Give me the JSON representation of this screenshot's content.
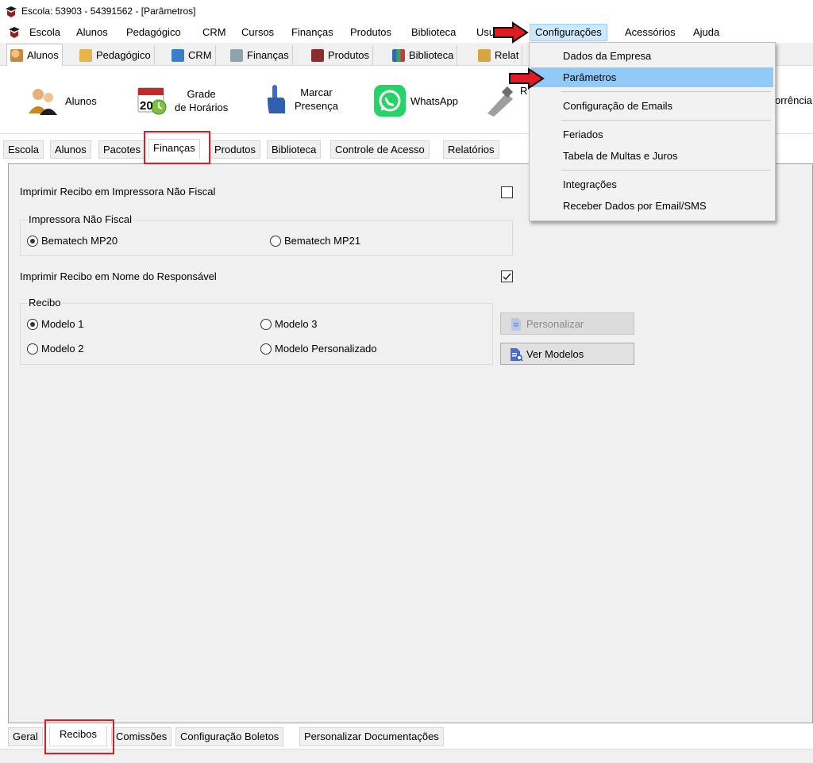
{
  "window": {
    "title": "Escola: 53903 - 54391562 - [Parâmetros]"
  },
  "menubar": {
    "items": [
      "Escola",
      "Alunos",
      "Pedagógico",
      "CRM",
      "Cursos",
      "Finanças",
      "Produtos",
      "Biblioteca",
      "Usu",
      "Configurações",
      "Acessórios",
      "Ajuda"
    ]
  },
  "toolbar_tabs": [
    "Alunos",
    "Pedagógico",
    "CRM",
    "Finanças",
    "Produtos",
    "Biblioteca",
    "Relat"
  ],
  "ribbon": {
    "alunos": "Alunos",
    "grade_line1": "Grade",
    "grade_line2": "de Horários",
    "grade_day": "20",
    "marcar_line1": "Marcar",
    "marcar_line2": "Presença",
    "whatsapp": "WhatsApp",
    "partial_r": "R",
    "ocorrencia": "orrência"
  },
  "secondary_tabs": [
    "Escola",
    "Alunos",
    "Pacotes",
    "Finanças",
    "Produtos",
    "Biblioteca",
    "Controle de Acesso",
    "Relatórios"
  ],
  "form": {
    "imprimir_nao_fiscal_label": "Imprimir Recibo em Impressora Não Fiscal",
    "imprimir_nao_fiscal_checked": false,
    "impressora_group": "Impressora Não Fiscal",
    "impressora_opt1": "Bematech MP20",
    "impressora_opt2": "Bematech MP21",
    "imprimir_responsavel_label": "Imprimir Recibo em Nome do Responsável",
    "imprimir_responsavel_checked": true,
    "recibo_group": "Recibo",
    "modelo1": "Modelo 1",
    "modelo2": "Modelo 2",
    "modelo3": "Modelo 3",
    "modelo_pers": "Modelo Personalizado",
    "btn_personalizar": "Personalizar",
    "btn_ver_modelos": "Ver Modelos"
  },
  "bottom_tabs": [
    "Geral",
    "Recibos",
    "Comissões",
    "Configuração Boletos",
    "Personalizar Documentações"
  ],
  "dropdown": {
    "items": [
      "Dados da Empresa",
      "Parâmetros",
      "Configuração de Emails",
      "Feriados",
      "Tabela de Multas e Juros",
      "Integrações",
      "Receber Dados por Email/SMS"
    ]
  },
  "colors": {
    "highlight_red": "#e01b22",
    "menu_hover": "#91c9f7"
  }
}
